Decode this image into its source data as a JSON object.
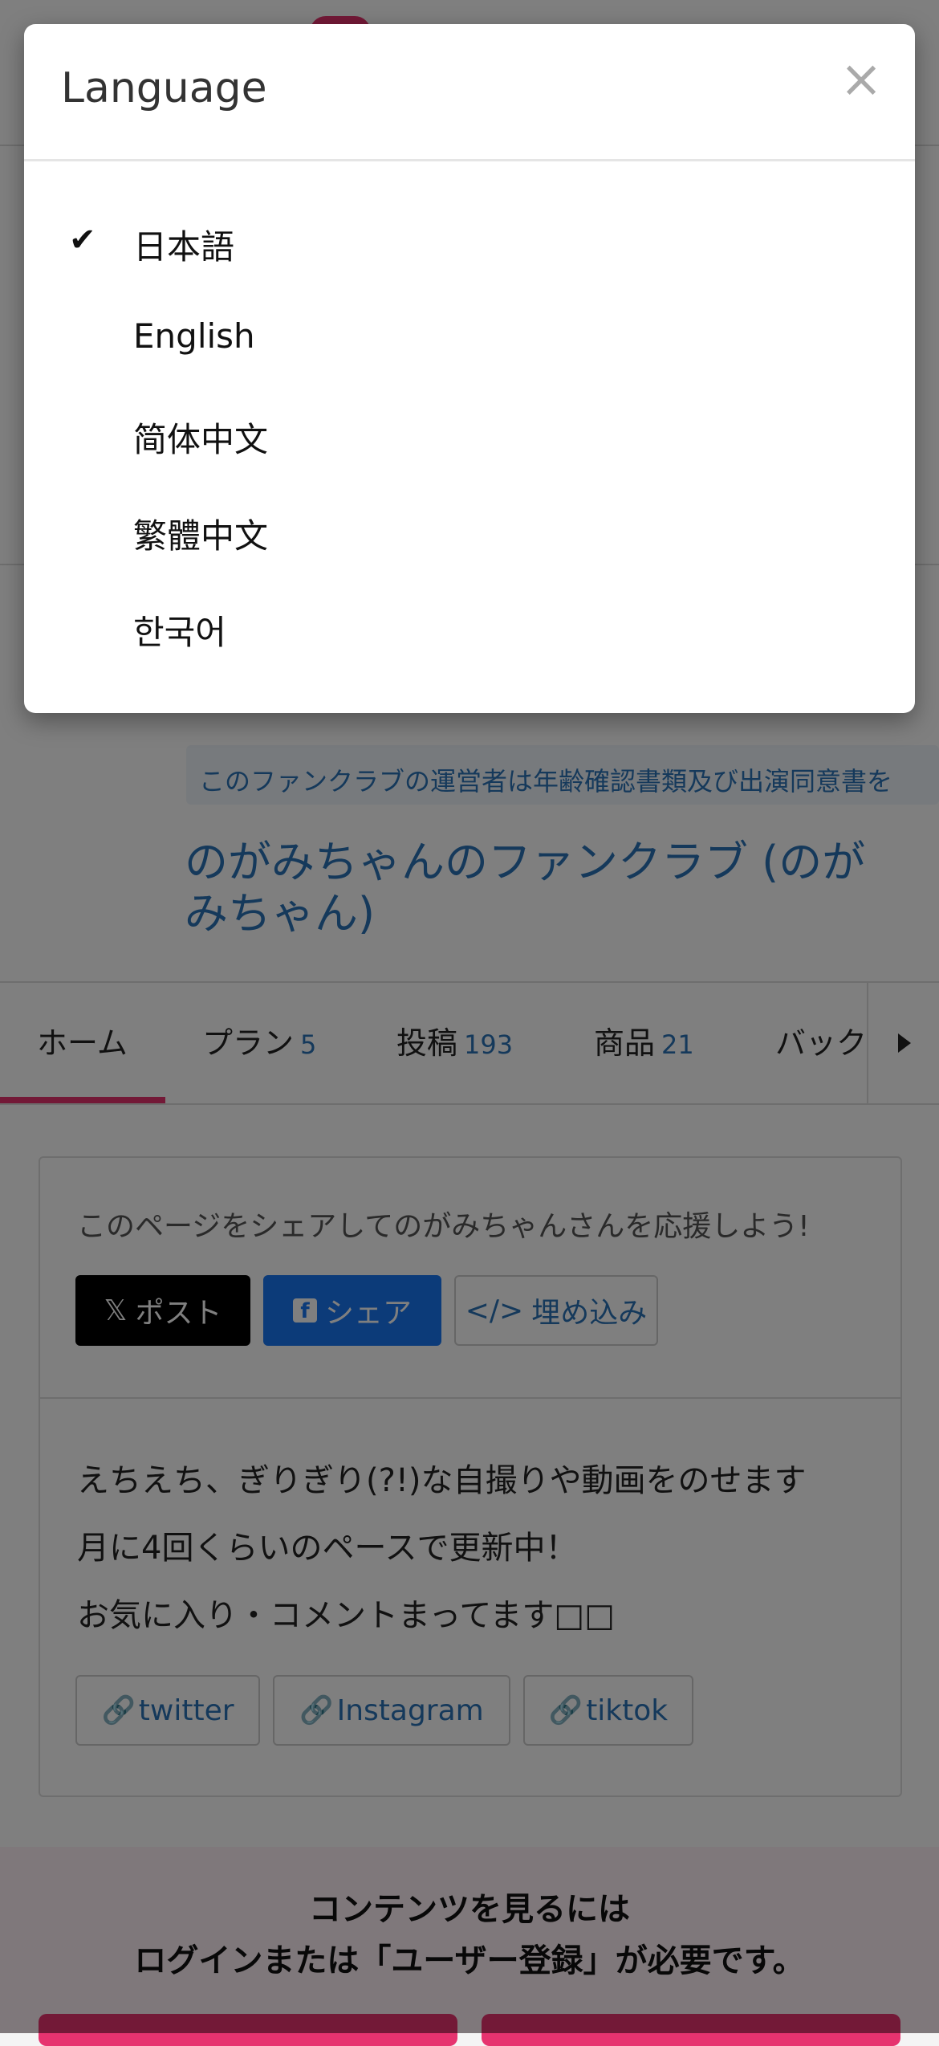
{
  "underlying": {
    "notice": "このファンクラブの運営者は年齢確認書類及び出演同意書を",
    "club_title": "のがみちゃんのファンクラブ (のがみちゃん)",
    "tabs": [
      {
        "label": "ホーム",
        "count": ""
      },
      {
        "label": "プラン",
        "count": "5"
      },
      {
        "label": "投稿",
        "count": "193"
      },
      {
        "label": "商品",
        "count": "21"
      },
      {
        "label": "バック",
        "count": ""
      }
    ],
    "share": {
      "text": "このページをシェアしてのがみちゃんさんを応援しよう!",
      "x_button": "ポスト",
      "fb_button": "シェア",
      "embed_button": "埋め込み"
    },
    "description": [
      "えちえち、ぎりぎり(?!)な自撮りや動画をのせます",
      "月に4回くらいのペースで更新中！",
      "お気に入り・コメントまってます□□"
    ],
    "links": [
      "twitter",
      "Instagram",
      "tiktok"
    ],
    "login_notice": {
      "line1": "コンテンツを見るには",
      "line2": "ログインまたは「ユーザー登録」が必要です。"
    }
  },
  "modal": {
    "title": "Language",
    "close": "×",
    "languages": [
      {
        "label": "日本語",
        "selected": true
      },
      {
        "label": "English",
        "selected": false
      },
      {
        "label": "简体中文",
        "selected": false
      },
      {
        "label": "繁體中文",
        "selected": false
      },
      {
        "label": "한국어",
        "selected": false
      }
    ],
    "check_glyph": "✔"
  },
  "colors": {
    "accent": "#e6336f",
    "link": "#2b73b7",
    "facebook": "#1877f2",
    "overlay": "rgba(0,0,0,0.5)"
  }
}
